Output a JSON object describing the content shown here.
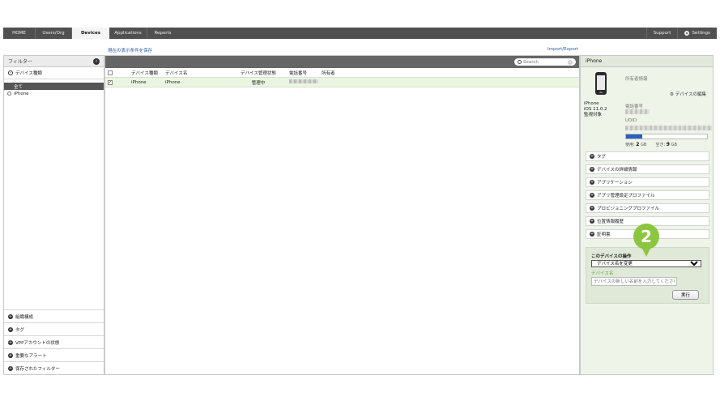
{
  "nav": {
    "tabs": [
      "HOME",
      "Users/Org",
      "Devices",
      "Applications",
      "Reports"
    ],
    "active_index": 2,
    "support": "Support",
    "settings": "Settings"
  },
  "links": {
    "save_view": "現在の表示条件を保存",
    "import_export": "Import/Export"
  },
  "filter": {
    "title": "フィルター",
    "device_type": "デバイス種類",
    "items": [
      "全て",
      "iPhone"
    ],
    "selected_index": 0,
    "bottom_sections": [
      "組織構成",
      "タグ",
      "VPPアカウントの状態",
      "重要なアラート",
      "保存されたフィルター"
    ]
  },
  "table": {
    "search_placeholder": "Search",
    "headers": [
      "デバイス種類",
      "デバイス名",
      "デバイス管理状態",
      "電話番号",
      "所有者"
    ],
    "rows": [
      {
        "type": "iPhone",
        "name": "iPhone",
        "status": "管理中"
      }
    ]
  },
  "detail": {
    "title": "iPhone",
    "owner_info": "所有者情報",
    "edit_device": "デバイスの編集",
    "model": "iPhone",
    "os": "iOS 11.0.2",
    "supervised": "監視対象",
    "phone_label": "電話番号",
    "udid_label": "UDID",
    "usage_fraction": 0.2,
    "used_label": "使用:",
    "used_value": "2",
    "used_unit": "GB",
    "free_label": "空き:",
    "free_value": "9",
    "free_unit": "GB",
    "sections": [
      "タグ",
      "デバイスの詳細情報",
      "アプリケーション",
      "アプリ管理設定プロファイル",
      "プロビジョニングプロファイル",
      "位置情報履歴",
      "証明書"
    ]
  },
  "actions": {
    "title": "このデバイスの操作",
    "selected": "デバイス名を変更",
    "field_label": "デバイス名",
    "placeholder": "デバイスの新しい名前を入力してください",
    "run": "実行"
  },
  "callout": "2",
  "colors": {
    "nav_bg": "#505050",
    "accent_green": "#8cc63f",
    "link_blue": "#2a5caa",
    "usage_blue": "#2b5fbf"
  }
}
